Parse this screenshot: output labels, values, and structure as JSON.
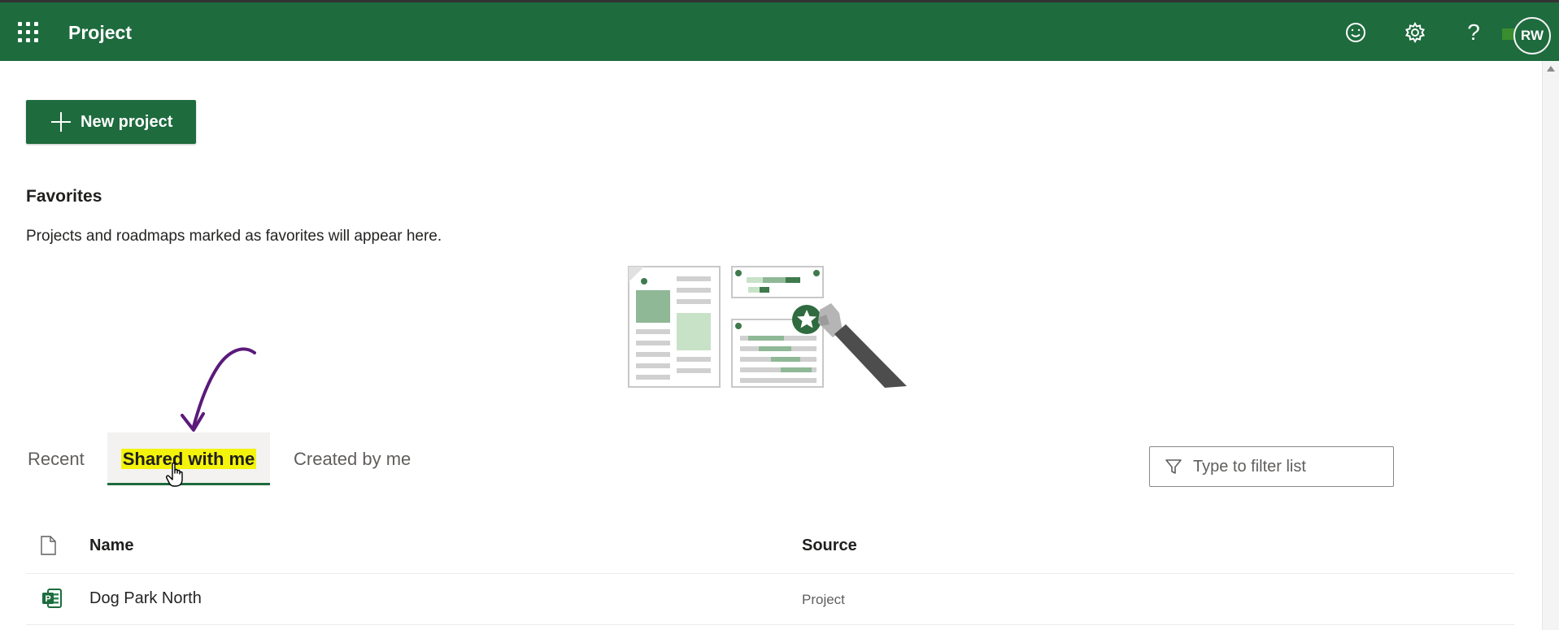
{
  "app": {
    "title": "Project",
    "bar_color": "#1e6b3e",
    "header_icons": [
      "waffle-icon",
      "smiley-icon",
      "gear-icon",
      "help-icon"
    ],
    "help_label": "?",
    "avatar_initials": "RW"
  },
  "toolbar": {
    "new_project_label": "New project"
  },
  "favorites": {
    "heading": "Favorites",
    "description": "Projects and roadmaps marked as favorites will appear here."
  },
  "tabs": [
    {
      "label": "Recent",
      "selected": false
    },
    {
      "label": "Shared with me",
      "selected": true
    },
    {
      "label": "Created by me",
      "selected": false
    }
  ],
  "filter": {
    "placeholder": "Type to filter list"
  },
  "table": {
    "columns": [
      "Name",
      "Source"
    ],
    "rows": [
      {
        "name": "Dog Park North",
        "source": "Project"
      }
    ]
  },
  "colors": {
    "accent": "#1e6b3e",
    "highlight": "#f4f30c",
    "annotation": "#5b1a7a"
  }
}
